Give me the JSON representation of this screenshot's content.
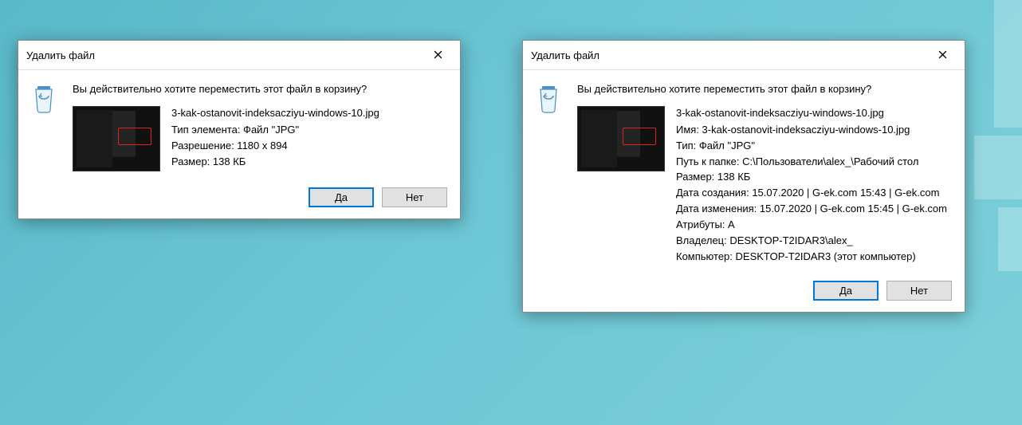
{
  "dialog1": {
    "title": "Удалить файл",
    "question": "Вы действительно хотите переместить этот файл в корзину?",
    "filename": "3-kak-ostanovit-indeksacziyu-windows-10.jpg",
    "lines": [
      "Тип элемента: Файл \"JPG\"",
      "Разрешение: 1180 x 894",
      "Размер: 138 КБ"
    ],
    "yes": "Да",
    "no": "Нет"
  },
  "dialog2": {
    "title": "Удалить файл",
    "question": "Вы действительно хотите переместить этот файл в корзину?",
    "filename": "3-kak-ostanovit-indeksacziyu-windows-10.jpg",
    "lines": [
      "Имя: 3-kak-ostanovit-indeksacziyu-windows-10.jpg",
      "Тип: Файл \"JPG\"",
      "Путь к папке: C:\\Пользователи\\alex_\\Рабочий стол",
      "Размер: 138 КБ",
      "Дата создания: 15.07.2020 | G-ek.com 15:43 | G-ek.com",
      "Дата изменения: 15.07.2020 | G-ek.com 15:45 | G-ek.com",
      "Атрибуты: A",
      "Владелец: DESKTOP-T2IDAR3\\alex_",
      "Компьютер: DESKTOP-T2IDAR3 (этот компьютер)"
    ],
    "yes": "Да",
    "no": "Нет"
  }
}
